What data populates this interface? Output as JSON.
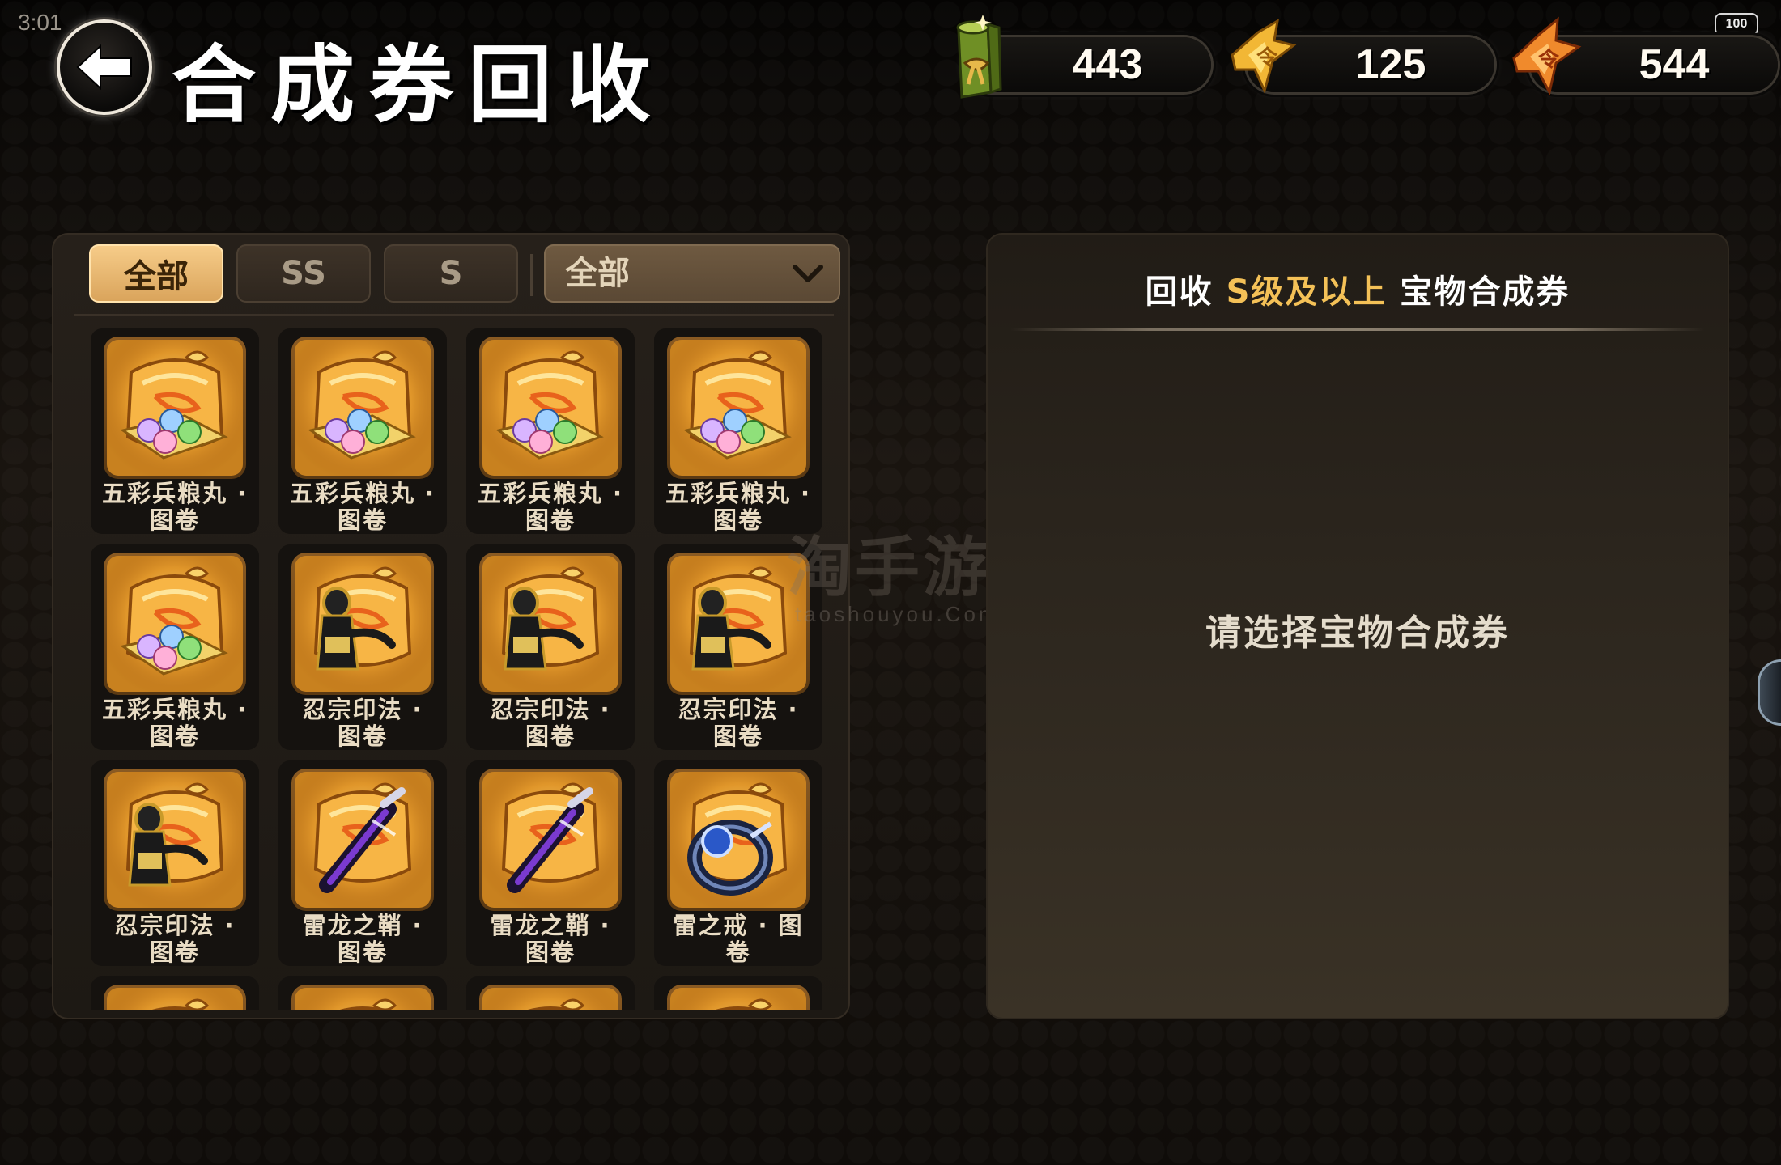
{
  "status_bar": {
    "time": "3:01",
    "battery": "100"
  },
  "header": {
    "title": "合成券回收"
  },
  "currencies": [
    {
      "name": "bamboo-scroll-icon",
      "amount": "443"
    },
    {
      "name": "gold-wing-token-icon",
      "amount": "125"
    },
    {
      "name": "red-wing-token-icon",
      "amount": "544"
    }
  ],
  "filters": {
    "tabs": [
      {
        "label": "全部",
        "active": true
      },
      {
        "label": "SS",
        "active": false
      },
      {
        "label": "S",
        "active": false
      }
    ],
    "dropdown_value": "全部"
  },
  "items": [
    {
      "name": "五彩兵粮丸·图卷",
      "label": "五彩兵粮丸 · 图卷",
      "art": "pills-icon"
    },
    {
      "name": "五彩兵粮丸·图卷",
      "label": "五彩兵粮丸 · 图卷",
      "art": "pills-icon"
    },
    {
      "name": "五彩兵粮丸·图卷",
      "label": "五彩兵粮丸 · 图卷",
      "art": "pills-icon"
    },
    {
      "name": "五彩兵粮丸·图卷",
      "label": "五彩兵粮丸 · 图卷",
      "art": "pills-icon"
    },
    {
      "name": "五彩兵粮丸·图卷",
      "label": "五彩兵粮丸 · 图卷",
      "art": "pills-icon"
    },
    {
      "name": "忍宗印法·图卷",
      "label": "忍宗印法 · 图卷",
      "art": "ninja-figure-icon"
    },
    {
      "name": "忍宗印法·图卷",
      "label": "忍宗印法 · 图卷",
      "art": "ninja-figure-icon"
    },
    {
      "name": "忍宗印法·图卷",
      "label": "忍宗印法 · 图卷",
      "art": "ninja-figure-icon"
    },
    {
      "name": "忍宗印法·图卷",
      "label": "忍宗印法 · 图卷",
      "art": "ninja-figure-icon"
    },
    {
      "name": "雷龙之鞘·图卷",
      "label": "雷龙之鞘 · 图卷",
      "art": "sheath-icon"
    },
    {
      "name": "雷龙之鞘·图卷",
      "label": "雷龙之鞘 · 图卷",
      "art": "sheath-icon"
    },
    {
      "name": "雷之戒·图卷",
      "label": "雷之戒 · 图卷",
      "art": "ring-icon"
    },
    {
      "name": "",
      "label": "",
      "art": "scroll-icon"
    },
    {
      "name": "",
      "label": "",
      "art": "scroll-icon"
    },
    {
      "name": "",
      "label": "",
      "art": "scroll-icon"
    },
    {
      "name": "",
      "label": "",
      "art": "scroll-icon"
    }
  ],
  "recycle_panel": {
    "header_prefix": "回收",
    "header_highlight": "S级及以上",
    "header_suffix": "宝物合成券",
    "empty_hint": "请选择宝物合成券"
  },
  "watermark": {
    "cn": "淘手游",
    "en": "taoshouyou.Com"
  },
  "colors": {
    "accent": "#f4c157",
    "tab_active": "#e6b46e",
    "panel": "#231d17"
  }
}
